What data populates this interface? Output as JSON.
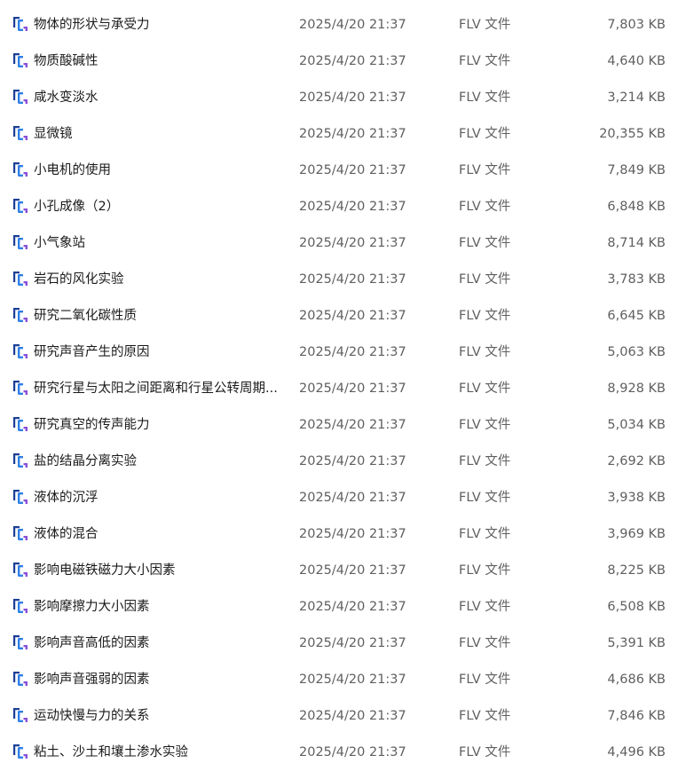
{
  "files": [
    {
      "name": "物体的形状与承受力",
      "date": "2025/4/20 21:37",
      "type": "FLV 文件",
      "size": "7,803 KB"
    },
    {
      "name": "物质酸碱性",
      "date": "2025/4/20 21:37",
      "type": "FLV 文件",
      "size": "4,640 KB"
    },
    {
      "name": "咸水变淡水",
      "date": "2025/4/20 21:37",
      "type": "FLV 文件",
      "size": "3,214 KB"
    },
    {
      "name": "显微镜",
      "date": "2025/4/20 21:37",
      "type": "FLV 文件",
      "size": "20,355 KB"
    },
    {
      "name": "小电机的使用",
      "date": "2025/4/20 21:37",
      "type": "FLV 文件",
      "size": "7,849 KB"
    },
    {
      "name": "小孔成像（2）",
      "date": "2025/4/20 21:37",
      "type": "FLV 文件",
      "size": "6,848 KB"
    },
    {
      "name": "小气象站",
      "date": "2025/4/20 21:37",
      "type": "FLV 文件",
      "size": "8,714 KB"
    },
    {
      "name": "岩石的风化实验",
      "date": "2025/4/20 21:37",
      "type": "FLV 文件",
      "size": "3,783 KB"
    },
    {
      "name": "研究二氧化碳性质",
      "date": "2025/4/20 21:37",
      "type": "FLV 文件",
      "size": "6,645 KB"
    },
    {
      "name": "研究声音产生的原因",
      "date": "2025/4/20 21:37",
      "type": "FLV 文件",
      "size": "5,063 KB"
    },
    {
      "name": "研究行星与太阳之间距离和行星公转周期...",
      "date": "2025/4/20 21:37",
      "type": "FLV 文件",
      "size": "8,928 KB"
    },
    {
      "name": "研究真空的传声能力",
      "date": "2025/4/20 21:37",
      "type": "FLV 文件",
      "size": "5,034 KB"
    },
    {
      "name": "盐的结晶分离实验",
      "date": "2025/4/20 21:37",
      "type": "FLV 文件",
      "size": "2,692 KB"
    },
    {
      "name": "液体的沉浮",
      "date": "2025/4/20 21:37",
      "type": "FLV 文件",
      "size": "3,938 KB"
    },
    {
      "name": "液体的混合",
      "date": "2025/4/20 21:37",
      "type": "FLV 文件",
      "size": "3,969 KB"
    },
    {
      "name": "影响电磁铁磁力大小因素",
      "date": "2025/4/20 21:37",
      "type": "FLV 文件",
      "size": "8,225 KB"
    },
    {
      "name": "影响摩擦力大小因素",
      "date": "2025/4/20 21:37",
      "type": "FLV 文件",
      "size": "6,508 KB"
    },
    {
      "name": "影响声音高低的因素",
      "date": "2025/4/20 21:37",
      "type": "FLV 文件",
      "size": "5,391 KB"
    },
    {
      "name": "影响声音强弱的因素",
      "date": "2025/4/20 21:37",
      "type": "FLV 文件",
      "size": "4,686 KB"
    },
    {
      "name": "运动快慢与力的关系",
      "date": "2025/4/20 21:37",
      "type": "FLV 文件",
      "size": "7,846 KB"
    },
    {
      "name": "粘土、沙土和壤土渗水实验",
      "date": "2025/4/20 21:37",
      "type": "FLV 文件",
      "size": "4,496 KB"
    }
  ],
  "icon": {
    "name": "video-file-icon",
    "colors": [
      "#1c3f95",
      "#2f7fe8",
      "#8a4fd8"
    ]
  }
}
